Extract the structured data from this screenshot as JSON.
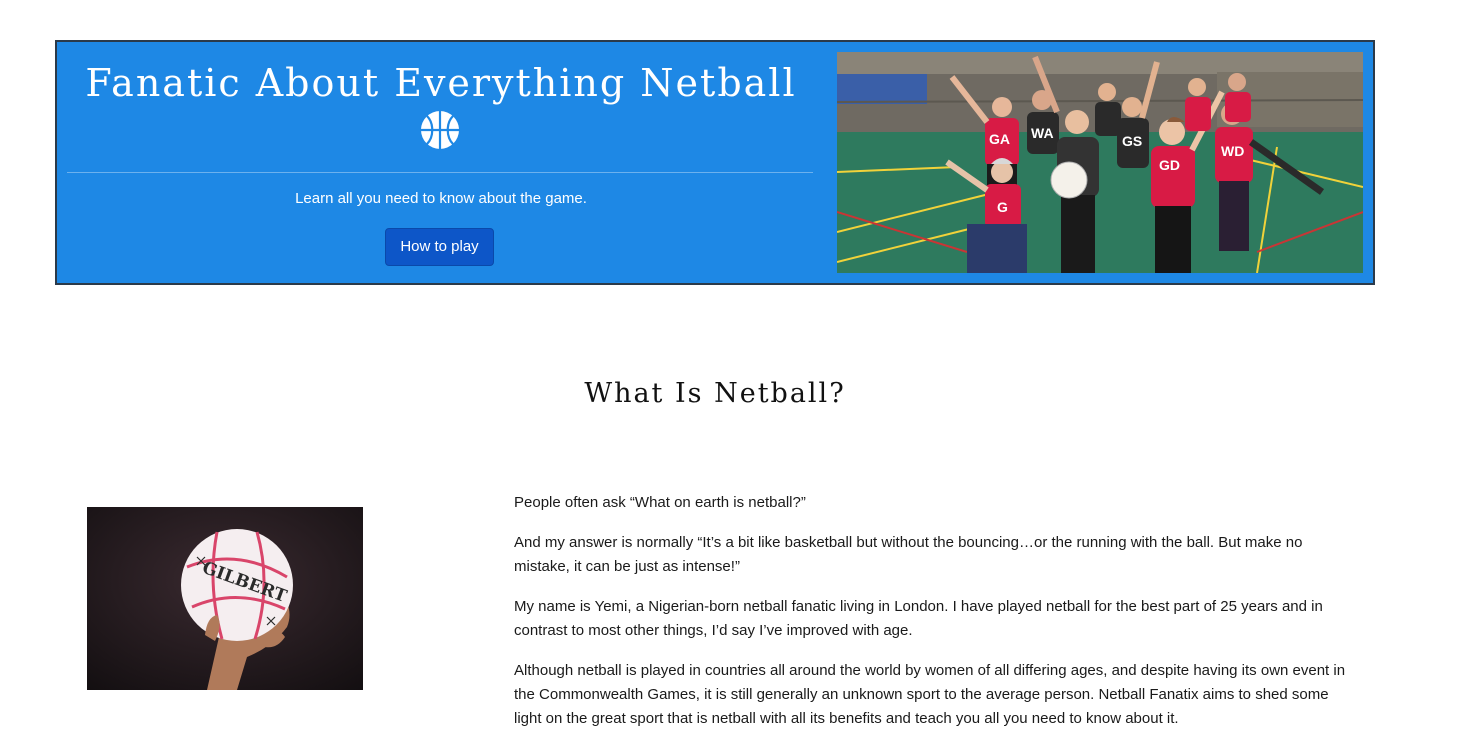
{
  "hero": {
    "title": "Fanatic About Everything Netball",
    "icon": "basketball-icon",
    "subtitle": "Learn all you need to know about the game.",
    "button_label": "How to play",
    "photo_jersey_labels": [
      "GA",
      "WA",
      "GS",
      "GD",
      "WD",
      "G"
    ],
    "colors": {
      "banner": "#1e88e5",
      "button": "#0d56c8"
    }
  },
  "section": {
    "title": "What Is Netball?"
  },
  "netball_image": {
    "brand": "GILBERT"
  },
  "article": {
    "paragraphs": [
      "People often ask “What on earth is netball?”",
      "And my answer is normally “It’s a bit like basketball but without the bouncing…or the running with the ball. But make no mistake, it can be just as intense!”",
      "My name is Yemi, a Nigerian-born netball fanatic living in London. I have played netball for the best part of 25 years and in contrast to most other things, I’d say I’ve improved with age.",
      "Although netball is played in countries all around the world by women of all differing ages, and despite having its own event in the Commonwealth Games, it is still generally an unknown sport to the average person. Netball Fanatix aims to shed some light on the great sport that is netball with all its benefits and teach you all you need to know about it."
    ]
  }
}
